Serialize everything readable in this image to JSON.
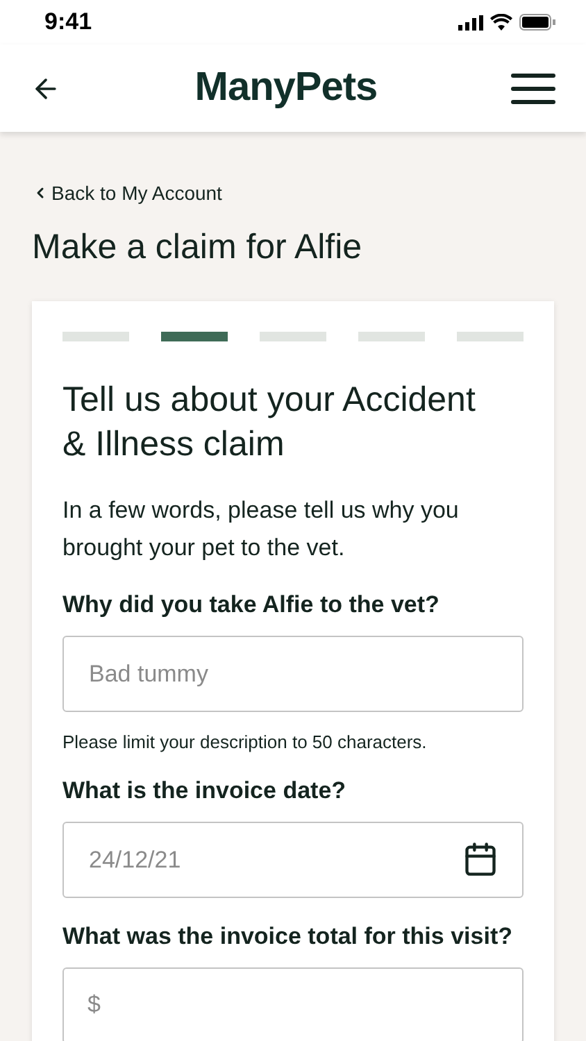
{
  "status_bar": {
    "time": "9:41"
  },
  "header": {
    "logo": "ManyPets"
  },
  "back_link": "Back to My Account",
  "page_title": "Make a claim for Alfie",
  "card": {
    "steps": [
      {
        "selected": false
      },
      {
        "selected": true
      },
      {
        "selected": false
      },
      {
        "selected": false
      },
      {
        "selected": false
      }
    ],
    "heading": "Tell us about your Accident & Illness claim",
    "intro": "In a few words, please tell us why you brought your pet to the vet.",
    "fields": [
      {
        "kind": "text",
        "label": "Why did you take Alfie to the vet?",
        "placeholder": "Bad tummy",
        "hint": "Please limit your description to 50 characters."
      },
      {
        "kind": "date",
        "label": "What is the invoice date?",
        "placeholder": "24/12/21"
      },
      {
        "kind": "currency",
        "label": "What was the invoice total for this visit?",
        "prefix": "$"
      }
    ]
  }
}
